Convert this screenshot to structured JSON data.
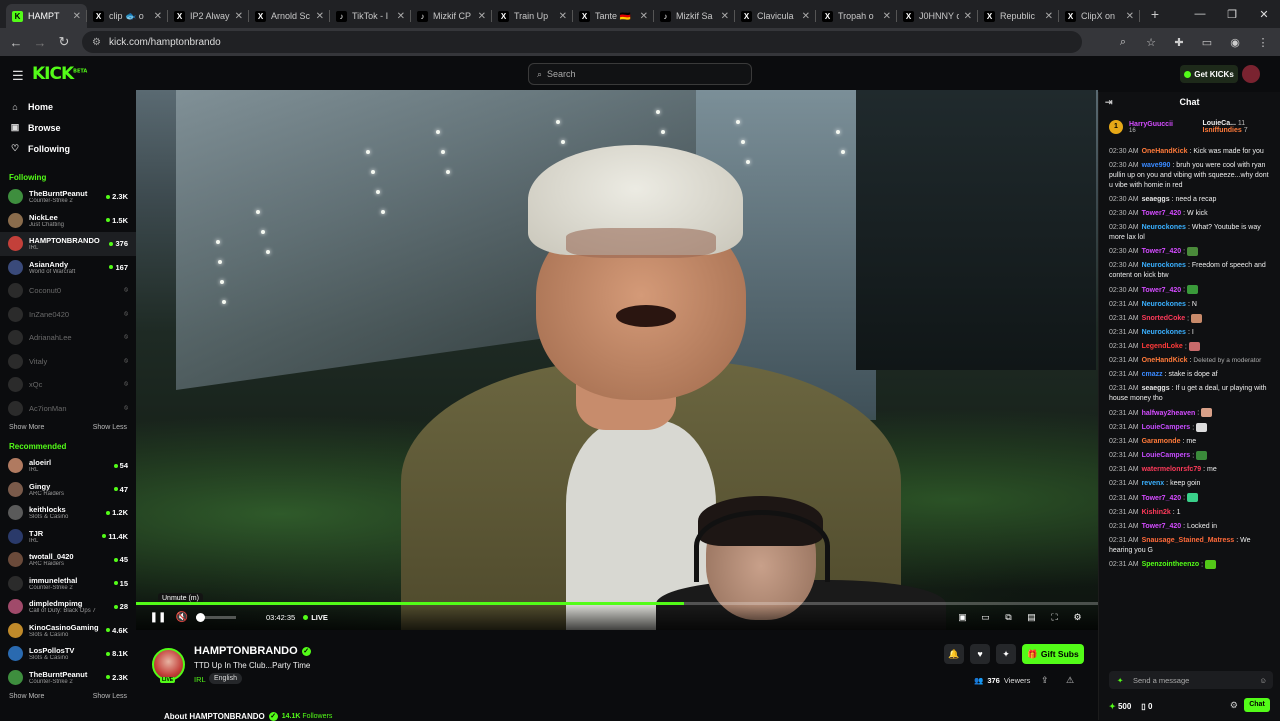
{
  "browser": {
    "tabs": [
      {
        "label": "HAMPT",
        "fav": "K",
        "favbg": "#53fc18",
        "favcolor": "#000",
        "active": true
      },
      {
        "label": "clip 🐟 o",
        "fav": "X",
        "favbg": "#000",
        "favcolor": "#fff"
      },
      {
        "label": "IP2 Alway",
        "fav": "X",
        "favbg": "#000",
        "favcolor": "#fff"
      },
      {
        "label": "Arnold Sc",
        "fav": "X",
        "favbg": "#000",
        "favcolor": "#fff"
      },
      {
        "label": "TikTok - I",
        "fav": "♪",
        "favbg": "#000",
        "favcolor": "#fff"
      },
      {
        "label": "Mizkif CP",
        "fav": "♪",
        "favbg": "#000",
        "favcolor": "#fff"
      },
      {
        "label": "Train Up",
        "fav": "X",
        "favbg": "#000",
        "favcolor": "#fff"
      },
      {
        "label": "Tante 🇩🇪",
        "fav": "X",
        "favbg": "#000",
        "favcolor": "#fff"
      },
      {
        "label": "Mizkif Sa",
        "fav": "♪",
        "favbg": "#000",
        "favcolor": "#fff"
      },
      {
        "label": "Clavicula",
        "fav": "X",
        "favbg": "#000",
        "favcolor": "#fff"
      },
      {
        "label": "Tropah o",
        "fav": "X",
        "favbg": "#000",
        "favcolor": "#fff"
      },
      {
        "label": "J0HNNY c",
        "fav": "X",
        "favbg": "#000",
        "favcolor": "#fff"
      },
      {
        "label": "Republic",
        "fav": "X",
        "favbg": "#000",
        "favcolor": "#fff"
      },
      {
        "label": "ClipX on",
        "fav": "X",
        "favbg": "#000",
        "favcolor": "#fff"
      }
    ],
    "url": "kick.com/hamptonbrando"
  },
  "topbar": {
    "logo": "KICK",
    "logo_beta": "BETA",
    "search_placeholder": "Search",
    "get_kicks": "Get KICKs"
  },
  "sidebar": {
    "nav": [
      {
        "label": "Home",
        "icon": "home-icon",
        "glyph": "⌂"
      },
      {
        "label": "Browse",
        "icon": "browse-icon",
        "glyph": "▣"
      },
      {
        "label": "Following",
        "icon": "heart-icon",
        "glyph": "♡"
      }
    ],
    "following_title": "Following",
    "following": [
      {
        "name": "TheBurntPeanut",
        "cat": "Counter-Strike 2",
        "viewers": "2.3K",
        "color": "#3e8e3e"
      },
      {
        "name": "NickLee",
        "cat": "Just Chatting",
        "viewers": "1.5K",
        "color": "#8a6c4c"
      },
      {
        "name": "HAMPTONBRANDO",
        "cat": "IRL",
        "viewers": "376",
        "color": "#c3403a",
        "selected": true
      },
      {
        "name": "AsianAndy",
        "cat": "World of Warcraft",
        "viewers": "167",
        "color": "#3a4a7a"
      },
      {
        "name": "Coconut0",
        "cat": "",
        "viewers": "",
        "offline": true
      },
      {
        "name": "InZane0420",
        "cat": "",
        "viewers": "",
        "offline": true
      },
      {
        "name": "AdrianahLee",
        "cat": "",
        "viewers": "",
        "offline": true
      },
      {
        "name": "Vitaly",
        "cat": "",
        "viewers": "",
        "offline": true
      },
      {
        "name": "xQc",
        "cat": "",
        "viewers": "",
        "offline": true
      },
      {
        "name": "Ac7ionMan",
        "cat": "",
        "viewers": "",
        "offline": true
      }
    ],
    "show_more": "Show More",
    "show_less": "Show Less",
    "recommended_title": "Recommended",
    "recommended": [
      {
        "name": "aloeirl",
        "cat": "IRL",
        "viewers": "54",
        "color": "#b07a60"
      },
      {
        "name": "Gingy",
        "cat": "ARC Raiders",
        "viewers": "47",
        "color": "#7a5a4a"
      },
      {
        "name": "keithlocks",
        "cat": "Slots & Casino",
        "viewers": "1.2K",
        "color": "#5a5a5a"
      },
      {
        "name": "TJR",
        "cat": "IRL",
        "viewers": "11.4K",
        "color": "#2a3a6a"
      },
      {
        "name": "twotall_0420",
        "cat": "ARC Raiders",
        "viewers": "45",
        "color": "#6a4a3a"
      },
      {
        "name": "immunelethal",
        "cat": "Counter-Strike 2",
        "viewers": "15",
        "color": "#2b2b2b"
      },
      {
        "name": "dimpledmpimg",
        "cat": "Call of Duty: Black Ops 7",
        "viewers": "28",
        "color": "#a04a6a"
      },
      {
        "name": "KinoCasinoGaming",
        "cat": "Slots & Casino",
        "viewers": "4.6K",
        "color": "#c08a2a"
      },
      {
        "name": "LosPollosTV",
        "cat": "Slots & Casino",
        "viewers": "8.1K",
        "color": "#2a6ab0"
      },
      {
        "name": "TheBurntPeanut",
        "cat": "Counter-Strike 2",
        "viewers": "2.3K",
        "color": "#3e8e3e"
      }
    ]
  },
  "player": {
    "tooltip": "Unmute (m)",
    "time": "03:42:35",
    "live": "LIVE",
    "progress_pct": 57
  },
  "stream": {
    "name": "HAMPTONBRANDO",
    "title": "TTD Up In The Club...Party Time",
    "category": "IRL",
    "language": "English",
    "live_badge": "LIVE",
    "gift": "Gift Subs",
    "viewers": "376",
    "viewers_label": "Viewers",
    "about": "About HAMPTONBRANDO",
    "followers": "14.1K",
    "followers_label": "Followers"
  },
  "chat": {
    "title": "Chat",
    "pinned": {
      "rank": "1",
      "user1": "HarryGuuccii",
      "count1": "16",
      "user2": "LouieCa...",
      "count2": "11",
      "user3": "Isniffundies",
      "count3": "7"
    },
    "messages": [
      {
        "ts": "02:30 AM",
        "user": "OneHandKick",
        "color": "#ff7a3a",
        "text": "Kick was made for you"
      },
      {
        "ts": "02:30 AM",
        "user": "wave990",
        "color": "#3a8aff",
        "text": "bruh you were cool with ryan pullin up on you and vibing with squeeze...why dont u vibe with homie in red"
      },
      {
        "ts": "02:30 AM",
        "user": "seaeggs",
        "color": "#e6e6e6",
        "text": "need a recap"
      },
      {
        "ts": "02:30 AM",
        "user": "Tower7_420",
        "color": "#d44cff",
        "text": "W kick"
      },
      {
        "ts": "02:30 AM",
        "user": "Neurockones",
        "color": "#3ab0ff",
        "text": "What? Youtube is way more lax lol"
      },
      {
        "ts": "02:30 AM",
        "user": "Tower7_420",
        "color": "#d44cff",
        "text": "",
        "emote": "#4a8a3a"
      },
      {
        "ts": "02:30 AM",
        "user": "Neurockones",
        "color": "#3ab0ff",
        "text": "Freedom of speech and content on kick btw"
      },
      {
        "ts": "02:30 AM",
        "user": "Tower7_420",
        "color": "#d44cff",
        "text": "",
        "emote": "#3a9a3a"
      },
      {
        "ts": "02:31 AM",
        "user": "Neurockones",
        "color": "#3ab0ff",
        "text": "N"
      },
      {
        "ts": "02:31 AM",
        "user": "SnortedCoke",
        "color": "#ff3a5a",
        "text": "",
        "emote": "#c88a6a"
      },
      {
        "ts": "02:31 AM",
        "user": "Neurockones",
        "color": "#3ab0ff",
        "text": "I"
      },
      {
        "ts": "02:31 AM",
        "user": "LegendLoke",
        "color": "#ff3a3a",
        "text": "",
        "emote": "#c86a6a"
      },
      {
        "ts": "02:31 AM",
        "user": "OneHandKick",
        "color": "#ff7a3a",
        "text": "Deleted by a moderator",
        "deleted": true
      },
      {
        "ts": "02:31 AM",
        "user": "cmazz",
        "color": "#3a8aff",
        "text": "stake is dope af"
      },
      {
        "ts": "02:31 AM",
        "user": "seaeggs",
        "color": "#e6e6e6",
        "text": "If u get a deal, ur playing with house money tho"
      },
      {
        "ts": "02:31 AM",
        "user": "halfway2heaven",
        "color": "#d44cff",
        "text": "",
        "emote": "#d8a088"
      },
      {
        "ts": "02:31 AM",
        "user": "LouieCampers",
        "color": "#c64cff",
        "text": "",
        "emote": "#dddddd"
      },
      {
        "ts": "02:31 AM",
        "user": "Garamonde",
        "color": "#ff7a3a",
        "text": "me"
      },
      {
        "ts": "02:31 AM",
        "user": "LouieCampers",
        "color": "#c64cff",
        "text": "",
        "emote": "#3a8a3a"
      },
      {
        "ts": "02:31 AM",
        "user": "watermelonrsfc79",
        "color": "#ff3a5a",
        "text": "me"
      },
      {
        "ts": "02:31 AM",
        "user": "revenx",
        "color": "#3ab0ff",
        "text": "keep goin"
      },
      {
        "ts": "02:31 AM",
        "user": "Tower7_420",
        "color": "#d44cff",
        "text": "",
        "emote": "#3ad08a"
      },
      {
        "ts": "02:31 AM",
        "user": "Kishin2k",
        "color": "#ff3a5a",
        "text": "1"
      },
      {
        "ts": "02:31 AM",
        "user": "Tower7_420",
        "color": "#d44cff",
        "text": "Locked in"
      },
      {
        "ts": "02:31 AM",
        "user": "Snausage_Stained_Matress",
        "color": "#ff6a3a",
        "text": "We hearing you G"
      },
      {
        "ts": "02:31 AM",
        "user": "Spenzointheenzo",
        "color": "#53fc18",
        "text": "",
        "emote": "#53c818"
      }
    ],
    "input_placeholder": "Send a message",
    "kicks": "500",
    "zero": "0",
    "send": "Chat"
  }
}
